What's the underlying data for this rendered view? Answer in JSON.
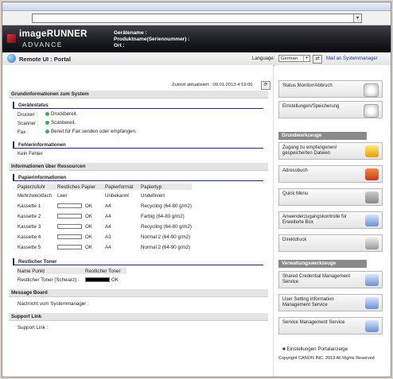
{
  "banner": {
    "brand_line1": "imageRUNNER",
    "brand_line2": "ADVANCE",
    "device_name_label": "Gerätename :",
    "product_label": "Produktname(Seriennummer) :",
    "location_label": "Ort :"
  },
  "nav": {
    "title": "Remote UI : Portal",
    "language_label": "Language:",
    "language_value": "German",
    "mail_link": "Mail an Systemmanager"
  },
  "main": {
    "last_updated": "Zuletzt aktualisiert : 09.01.2013 4:19:00",
    "basic_info_header": "Grundinformationen zum System",
    "device_status_header": "Gerätestatus",
    "status": [
      {
        "label": "Drucker :",
        "value": "Druckbereit."
      },
      {
        "label": "Scanner :",
        "value": "Scanbereit."
      },
      {
        "label": "Fax :",
        "value": "Bereit für Fax senden oder empfangen."
      }
    ],
    "error_header": "Fehlerinformationen",
    "error_value": "Kein Fehler",
    "resources_header": "Informationen über Ressourcen",
    "paper_header": "Papierinformationen",
    "paper_columns": [
      "Papierzufuhr",
      "Restliches Papier",
      "Papierformat",
      "Papiertyp"
    ],
    "paper_rows": [
      {
        "source": "Mehrzweckfach",
        "remaining": "Leer",
        "format": "Unbekannt",
        "type": "Undefiniert"
      },
      {
        "source": "Kassette 1",
        "remaining": "OK",
        "format": "A4",
        "type": "Recycling (64-80 g/m2)"
      },
      {
        "source": "Kassette 2",
        "remaining": "OK",
        "format": "A4",
        "type": "Farbig (64-80 g/m2)"
      },
      {
        "source": "Kassette 3",
        "remaining": "OK",
        "format": "A4",
        "type": "Recycling (64-80 g/m2)"
      },
      {
        "source": "Kassette 4",
        "remaining": "OK",
        "format": "A3",
        "type": "Normal 2 (64-90 g/m2)"
      },
      {
        "source": "Kassette 5",
        "remaining": "OK",
        "format": "A4",
        "type": "Normal 2 (64-90 g/m2)"
      }
    ],
    "toner_header": "Restlicher Toner",
    "toner_columns": [
      "Name Punkt",
      "Restlicher Toner"
    ],
    "toner_row": {
      "name": "Restlicher Toner (Schwarz) :",
      "value": "OK"
    },
    "message_header": "Message Board",
    "message_label": "Nachricht vom Systemmanager :",
    "support_header": "Support Link",
    "support_label": "Support Link :"
  },
  "side": {
    "status_monitor": "Status Monitor/Abbruch",
    "settings": "Einstellungen/Speicherung",
    "basic_tools_header": "Grundwerkzeuge",
    "tools": [
      "Zugang zu empfangenen/ gespeicherten Dateien",
      "Adressbuch",
      "Quick Menu",
      "Anwenderzugangskontrolle für Erweiterte Box",
      "Direktdruck"
    ],
    "admin_tools_header": "Verwaltungswerkzeuge",
    "admin_tools": [
      "Shared Credential Management Service",
      "User Setting Information Management Service",
      "Service Management Service"
    ],
    "portal_settings": "Einstellungen Portalanzeige",
    "copyright": "Copyright CANON INC. 2013 All Rights Reserved"
  },
  "colors": {
    "accent_dark": "#1e2e6a",
    "status_green": "#3caa5a",
    "banner_dark": "#1b1c20"
  }
}
